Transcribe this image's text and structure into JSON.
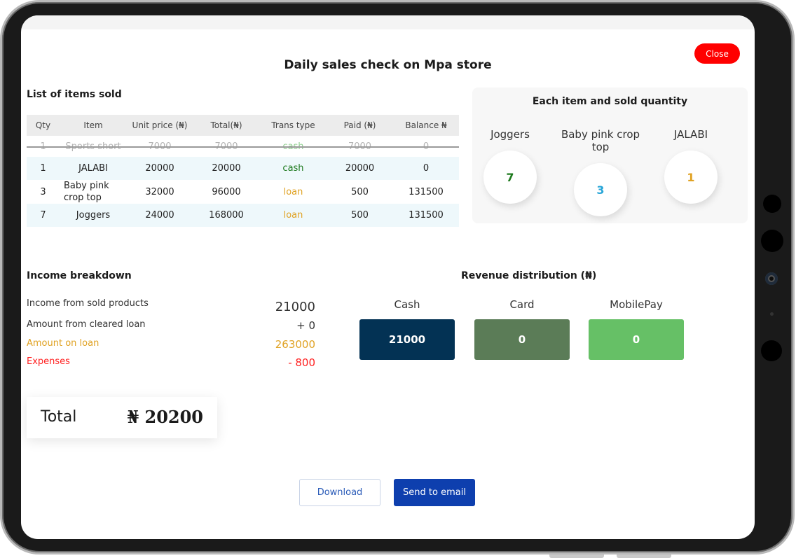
{
  "title": "Daily sales check on Mpa store",
  "close_label": "Close",
  "items_section_title": "List of items sold",
  "table": {
    "headers": [
      "Qty",
      "Item",
      "Unit price (₦)",
      "Total(₦)",
      "Trans type",
      "Paid (₦)",
      "Balance ₦"
    ],
    "struck_row": [
      "1",
      "Sports short",
      "7000",
      "7000",
      "cash",
      "7000",
      "0"
    ],
    "rows": [
      [
        "1",
        "JALABI",
        "20000",
        "20000",
        "cash",
        "20000",
        "0"
      ],
      [
        "3",
        "Baby pink crop top",
        "32000",
        "96000",
        "loan",
        "500",
        "131500"
      ],
      [
        "7",
        "Joggers",
        "24000",
        "168000",
        "loan",
        "500",
        "131500"
      ]
    ]
  },
  "qty_panel": {
    "title": "Each item and sold quantity",
    "items": [
      {
        "name": "Joggers",
        "qty": "7",
        "color": "#1e7a1e"
      },
      {
        "name": "Baby pink crop top",
        "qty": "3",
        "color": "#2aa6d8"
      },
      {
        "name": "JALABI",
        "qty": "1",
        "color": "#e0a223"
      }
    ]
  },
  "income": {
    "title": "Income breakdown",
    "rows": [
      {
        "label": "Income from sold products",
        "value": "21000"
      },
      {
        "label": "Amount from cleared loan",
        "value": "+ 0"
      },
      {
        "label": "Amount on loan",
        "value": "263000"
      },
      {
        "label": "Expenses",
        "value": "- 800"
      }
    ]
  },
  "total": {
    "label": "Total",
    "value": "₦ 20200"
  },
  "revenue": {
    "title": "Revenue distribution (₦)",
    "items": [
      {
        "label": "Cash",
        "value": "21000",
        "color": "#033254"
      },
      {
        "label": "Card",
        "value": "0",
        "color": "#5b7c57"
      },
      {
        "label": "MobilePay",
        "value": "0",
        "color": "#66c066"
      }
    ]
  },
  "buttons": {
    "download": "Download",
    "email": "Send to email"
  }
}
